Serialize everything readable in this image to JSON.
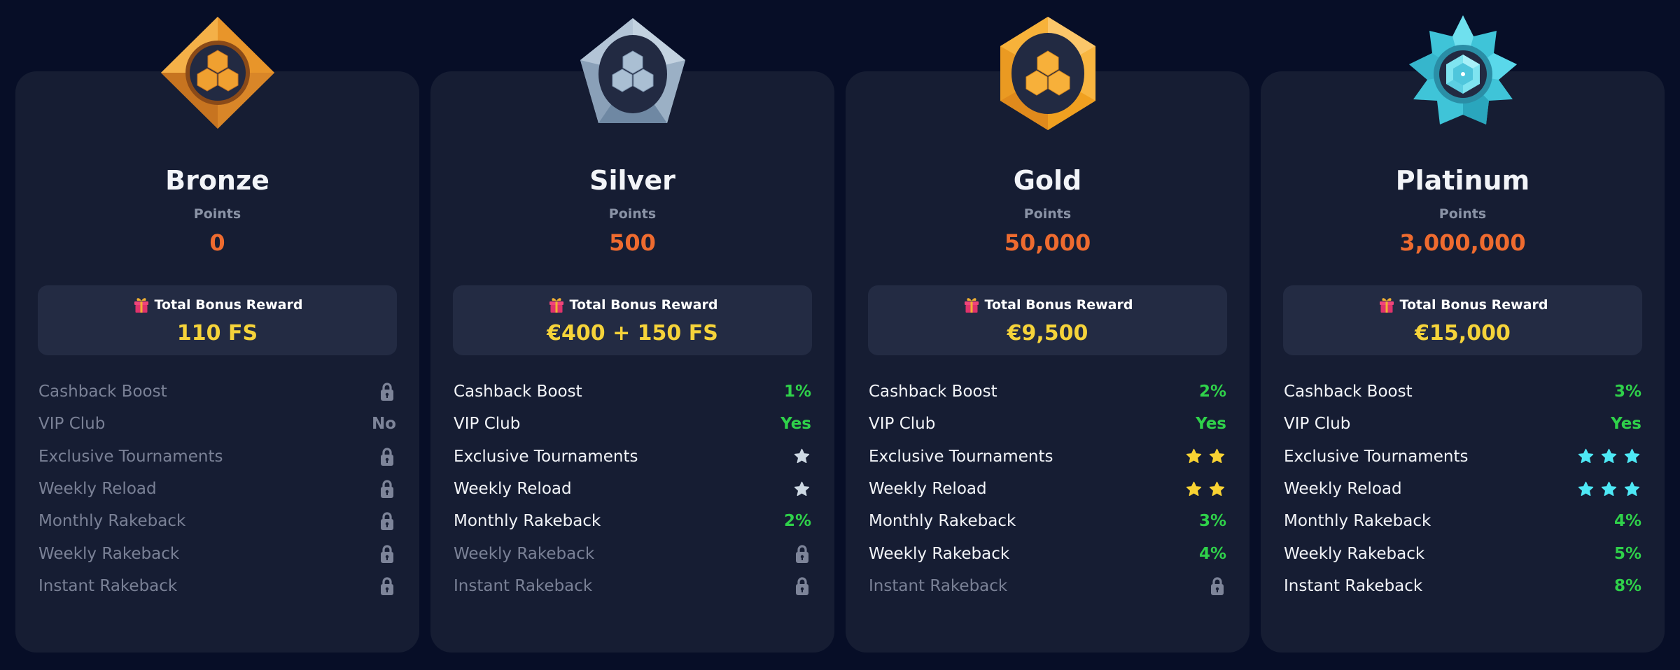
{
  "colors": {
    "background": "#070e27",
    "card": "#161d33",
    "bonus_box": "#232b43",
    "points_value": "#ee6b2f",
    "bonus_value": "#f5d33a",
    "positive_value": "#2fd14a",
    "locked": "#7d8499"
  },
  "tiers": [
    {
      "name": "Bronze",
      "badge_icon": "bronze-diamond-badge-icon",
      "points_label": "Points",
      "points": "0",
      "bonus_label": "Total Bonus Reward",
      "bonus_value": "110 FS",
      "features": [
        {
          "label": "Cashback Boost",
          "type": "lock",
          "value": ""
        },
        {
          "label": "VIP Club",
          "type": "no",
          "value": "No"
        },
        {
          "label": "Exclusive Tournaments",
          "type": "lock",
          "value": ""
        },
        {
          "label": "Weekly Reload",
          "type": "lock",
          "value": ""
        },
        {
          "label": "Monthly Rakeback",
          "type": "lock",
          "value": ""
        },
        {
          "label": "Weekly Rakeback",
          "type": "lock",
          "value": ""
        },
        {
          "label": "Instant Rakeback",
          "type": "lock",
          "value": ""
        }
      ]
    },
    {
      "name": "Silver",
      "badge_icon": "silver-pentagon-badge-icon",
      "points_label": "Points",
      "points": "500",
      "bonus_label": "Total Bonus Reward",
      "bonus_value": "€400 + 150 FS",
      "star_color": "#cdd8e3",
      "features": [
        {
          "label": "Cashback Boost",
          "type": "text",
          "value": "1%"
        },
        {
          "label": "VIP Club",
          "type": "text",
          "value": "Yes"
        },
        {
          "label": "Exclusive Tournaments",
          "type": "stars",
          "value": 1
        },
        {
          "label": "Weekly Reload",
          "type": "stars",
          "value": 1
        },
        {
          "label": "Monthly Rakeback",
          "type": "text",
          "value": "2%"
        },
        {
          "label": "Weekly Rakeback",
          "type": "lock",
          "value": ""
        },
        {
          "label": "Instant Rakeback",
          "type": "lock",
          "value": ""
        }
      ]
    },
    {
      "name": "Gold",
      "badge_icon": "gold-hexagon-badge-icon",
      "points_label": "Points",
      "points": "50,000",
      "bonus_label": "Total Bonus Reward",
      "bonus_value": "€9,500",
      "star_color": "#f8d233",
      "features": [
        {
          "label": "Cashback Boost",
          "type": "text",
          "value": "2%"
        },
        {
          "label": "VIP Club",
          "type": "text",
          "value": "Yes"
        },
        {
          "label": "Exclusive Tournaments",
          "type": "stars",
          "value": 2
        },
        {
          "label": "Weekly Reload",
          "type": "stars",
          "value": 2
        },
        {
          "label": "Monthly Rakeback",
          "type": "text",
          "value": "3%"
        },
        {
          "label": "Weekly Rakeback",
          "type": "text",
          "value": "4%"
        },
        {
          "label": "Instant Rakeback",
          "type": "lock",
          "value": ""
        }
      ]
    },
    {
      "name": "Platinum",
      "badge_icon": "platinum-star-badge-icon",
      "points_label": "Points",
      "points": "3,000,000",
      "bonus_label": "Total Bonus Reward",
      "bonus_value": "€15,000",
      "star_color": "#4ee8f5",
      "features": [
        {
          "label": "Cashback Boost",
          "type": "text",
          "value": "3%"
        },
        {
          "label": "VIP Club",
          "type": "text",
          "value": "Yes"
        },
        {
          "label": "Exclusive Tournaments",
          "type": "stars",
          "value": 3
        },
        {
          "label": "Weekly Reload",
          "type": "stars",
          "value": 3
        },
        {
          "label": "Monthly Rakeback",
          "type": "text",
          "value": "4%"
        },
        {
          "label": "Weekly Rakeback",
          "type": "text",
          "value": "5%"
        },
        {
          "label": "Instant Rakeback",
          "type": "text",
          "value": "8%"
        }
      ]
    }
  ]
}
